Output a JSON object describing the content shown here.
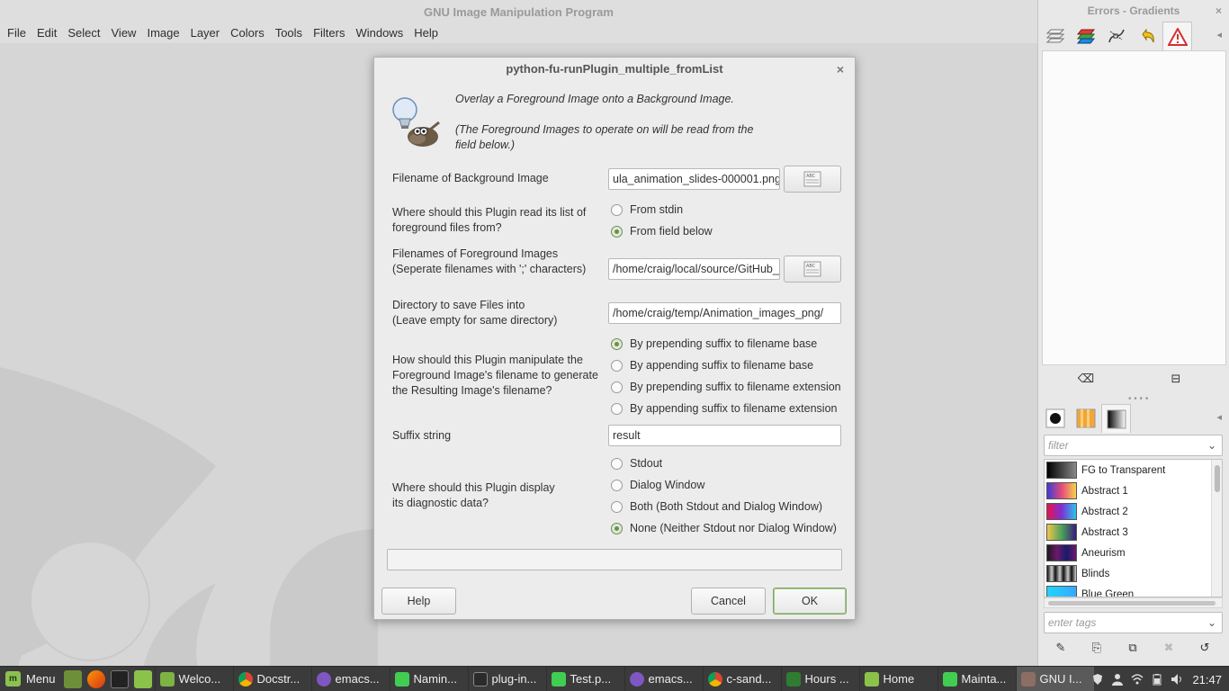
{
  "main": {
    "title": "GNU Image Manipulation Program",
    "menu": [
      "File",
      "Edit",
      "Select",
      "View",
      "Image",
      "Layer",
      "Colors",
      "Tools",
      "Filters",
      "Windows",
      "Help"
    ]
  },
  "dialog": {
    "title": "python-fu-runPlugin_multiple_fromList",
    "close": "×",
    "description_1": "Overlay a Foreground Image onto a Background Image.",
    "description_2a": "(The Foreground Images to operate on will be read from the",
    "description_2b": "field below.)",
    "bg_label": "Filename of Background Image",
    "bg_value": "ula_animation_slides-000001.png",
    "source_label_1": "Where should this Plugin read its list of",
    "source_label_2": "foreground files from?",
    "source_options": [
      "From stdin",
      "From field below"
    ],
    "source_selected": 1,
    "fg_label_1": "Filenames of Foreground Images",
    "fg_label_2": "(Seperate filenames with ';' characters)",
    "fg_value": "/home/craig/local/source/GitHub_",
    "dir_label_1": "Directory to save Files into",
    "dir_label_2": "(Leave empty for same directory)",
    "dir_value": "/home/craig/temp/Animation_images_png/",
    "manip_label_1": "How should this Plugin manipulate the",
    "manip_label_2": "Foreground Image's filename to generate",
    "manip_label_3": "the Resulting Image's filename?",
    "manip_options": [
      "By prepending suffix to filename base",
      "By appending suffix to filename base",
      "By prepending suffix to filename extension",
      "By appending suffix to filename extension"
    ],
    "manip_selected": 0,
    "suffix_label": "Suffix string",
    "suffix_value": "result",
    "diag_label_1": "Where should this Plugin display",
    "diag_label_2": "its diagnostic data?",
    "diag_options": [
      "Stdout",
      "Dialog Window",
      "Both (Both Stdout and Dialog Window)",
      "None (Neither Stdout nor Dialog Window)"
    ],
    "diag_selected": 3,
    "help_button": "Help",
    "cancel_button": "Cancel",
    "ok_button": "OK"
  },
  "dock": {
    "title": "Errors - Gradients",
    "close": "×",
    "gradient_filter_placeholder": "filter",
    "tag_placeholder": "enter tags",
    "gradients": [
      {
        "name": "FG to Transparent",
        "colors": [
          "#000000",
          "#555555"
        ]
      },
      {
        "name": "Abstract 1",
        "colors": [
          "#3b3bd6",
          "#e54a7a",
          "#f5d34a"
        ]
      },
      {
        "name": "Abstract 2",
        "colors": [
          "#e6134a",
          "#7e2fd6",
          "#2cc4e8"
        ]
      },
      {
        "name": "Abstract 3",
        "colors": [
          "#f0c64a",
          "#4aa25a",
          "#3a1b7a"
        ]
      },
      {
        "name": "Aneurism",
        "colors": [
          "#1a1a1a",
          "#6b1a6b",
          "#1a1a6b"
        ]
      },
      {
        "name": "Blinds",
        "colors": [
          "#111111",
          "#cccccc",
          "#111111"
        ]
      },
      {
        "name": "Blue Green",
        "colors": [
          "#1fd5ff",
          "#37a8ff"
        ]
      }
    ]
  },
  "taskbar": {
    "menu_label": "Menu",
    "tasks": [
      {
        "label": "Welco...",
        "color": "#7cb342"
      },
      {
        "label": "Docstr...",
        "color": "#db4437"
      },
      {
        "label": "emacs...",
        "color": "#7e57c2"
      },
      {
        "label": "Namin...",
        "color": "#41cd52"
      },
      {
        "label": "plug-in...",
        "color": "#2b2b2b"
      },
      {
        "label": "Test.p...",
        "color": "#41cd52"
      },
      {
        "label": "emacs...",
        "color": "#7e57c2"
      },
      {
        "label": "c-sand...",
        "color": "#db4437"
      },
      {
        "label": "Hours ...",
        "color": "#2e7d32"
      },
      {
        "label": "Home",
        "color": "#8bc34a"
      },
      {
        "label": "Mainta...",
        "color": "#41cd52"
      },
      {
        "label": "GNU I...",
        "color": "#8d6e63"
      }
    ],
    "clock": "21:47"
  }
}
